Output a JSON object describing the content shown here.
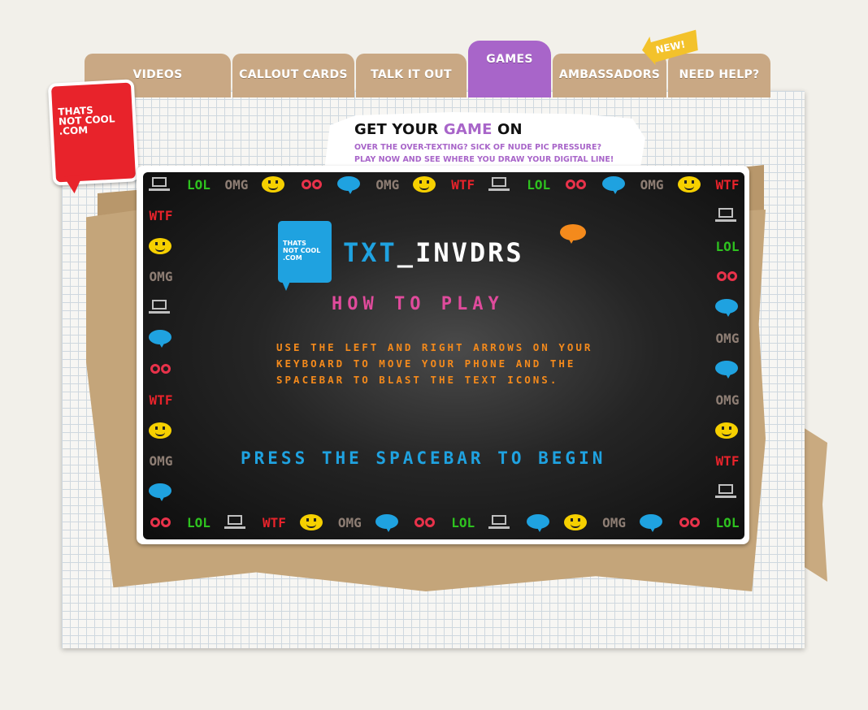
{
  "nav": {
    "tabs": [
      {
        "label": "VIDEOS"
      },
      {
        "label": "CALLOUT CARDS"
      },
      {
        "label": "TALK IT OUT"
      },
      {
        "label": "GAMES"
      },
      {
        "label": "AMBASSADORS"
      },
      {
        "label": "NEED HELP?"
      }
    ],
    "new_badge": "NEW!"
  },
  "logo": {
    "text": "THATS\nNOT COOL\n.COM"
  },
  "promo": {
    "title_before": "GET YOUR ",
    "title_accent": "GAME",
    "title_after": " ON",
    "line1": "OVER THE OVER-TEXTING?  SICK OF NUDE PIC PRESSURE?",
    "line2": "PLAY NOW AND SEE WHERE YOU DRAW YOUR DIGITAL LINE!"
  },
  "game": {
    "logo_text": "THATS\nNOT COOL\n.COM",
    "title_prefix": "TXT",
    "title_suffix": "_INVDRS",
    "how_to_play": "HOW TO PLAY",
    "instructions": "USE THE LEFT AND RIGHT ARROWS ON YOUR KEYBOARD TO MOVE YOUR PHONE AND THE SPACEBAR TO BLAST THE TEXT ICONS.",
    "press_start": "PRESS THE SPACEBAR TO BEGIN"
  },
  "border_icons": {
    "top": [
      "laptop",
      "lol",
      "omg",
      "smiley",
      "bra",
      "bubble",
      "omg",
      "smiley",
      "wtf",
      "laptop",
      "lol",
      "bra",
      "bubble",
      "omg",
      "smiley",
      "wtf"
    ],
    "left": [
      "wtf",
      "smiley",
      "omg",
      "laptop",
      "bubble",
      "bra",
      "wtf",
      "smiley",
      "omg",
      "bubble"
    ],
    "right": [
      "laptop",
      "lol",
      "bra",
      "bubble",
      "omg",
      "bubble",
      "omg",
      "smiley",
      "wtf",
      "laptop"
    ],
    "bottom": [
      "bra",
      "lol",
      "laptop",
      "wtf",
      "smiley",
      "omg",
      "bubble",
      "bra",
      "lol",
      "laptop",
      "bubble",
      "smiley",
      "omg",
      "bubble",
      "bra",
      "lol"
    ],
    "labels": {
      "lol": "LOL",
      "omg": "OMG",
      "wtf": "WTF"
    }
  },
  "colors": {
    "accent_purple": "#a865c9",
    "logo_red": "#e8232b",
    "game_blue": "#1fa2e0",
    "game_pink": "#e04b9c",
    "game_orange": "#f48a1c"
  }
}
